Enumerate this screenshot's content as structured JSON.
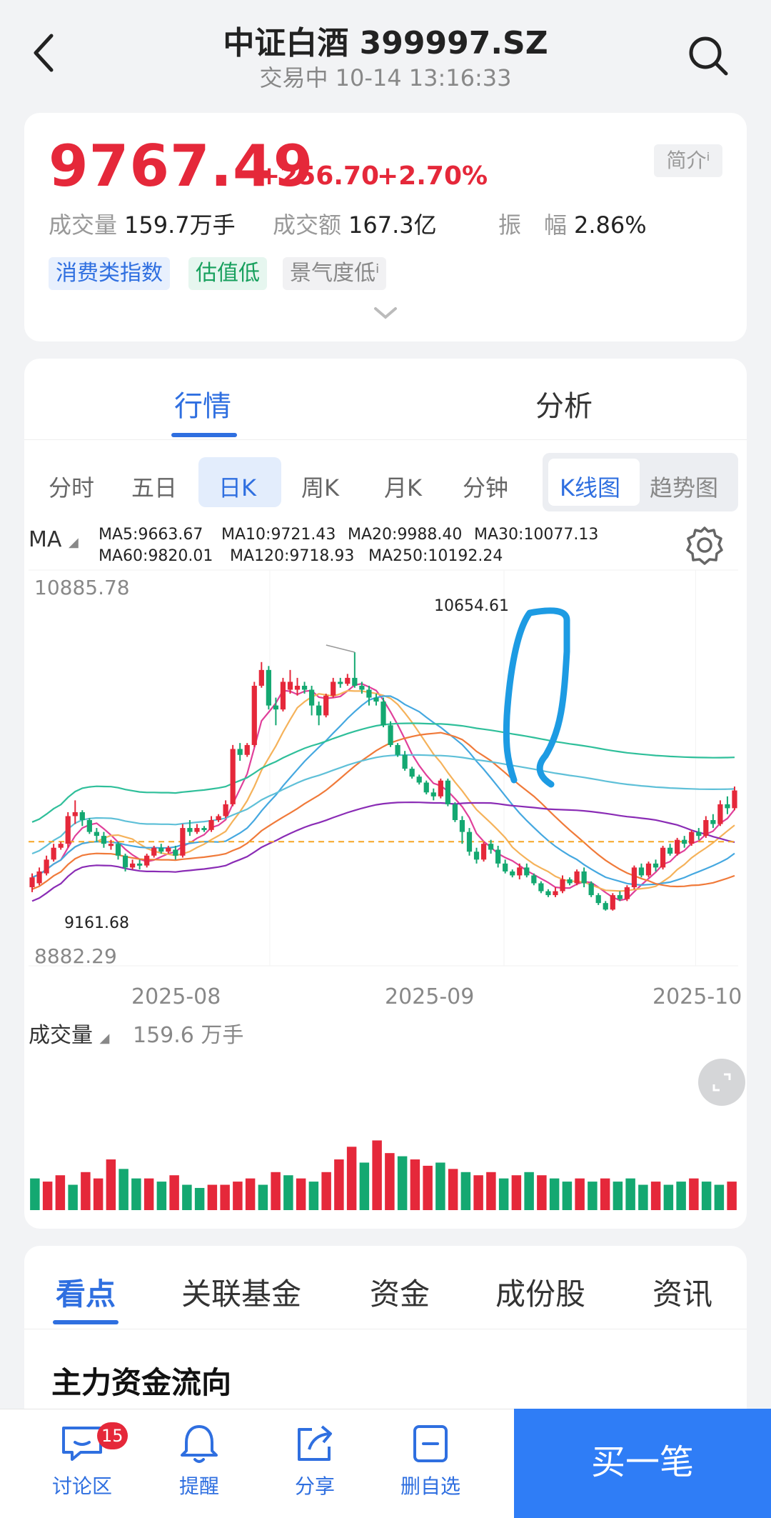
{
  "header": {
    "title": "中证白酒 399997.SZ",
    "subtitle": "交易中 10-14 13:16:33"
  },
  "quote": {
    "price": "9767.49",
    "change": "+256.70",
    "change_pct": "+2.70%",
    "intro_label": "简介ⁱ",
    "stats": [
      {
        "label": "成交量",
        "value": "159.7万手"
      },
      {
        "label": "成交额",
        "value": "167.3亿"
      },
      {
        "label": "振　幅",
        "value": "2.86%"
      }
    ],
    "tags": [
      "消费类指数",
      "估值低",
      "景气度低ⁱ"
    ]
  },
  "main_tabs": [
    "行情",
    "分析"
  ],
  "periods": [
    "分时",
    "五日",
    "日K",
    "周K",
    "月K",
    "分钟"
  ],
  "active_period": "日K",
  "chart_modes": [
    "K线图",
    "趋势图"
  ],
  "ma": {
    "selector": "MA",
    "values": [
      {
        "label": "MA5:9663.67",
        "color": "#e0409a"
      },
      {
        "label": "MA10:9721.43",
        "color": "#f5b25a"
      },
      {
        "label": "MA20:9988.40",
        "color": "#45a8e0"
      },
      {
        "label": "MA30:10077.13",
        "color": "#f07a3a"
      },
      {
        "label": "MA60:9820.01",
        "color": "#8a2cb5"
      },
      {
        "label": "MA120:9718.93",
        "color": "#5fc0d8"
      },
      {
        "label": "MA250:10192.24",
        "color": "#2fbf9a"
      }
    ]
  },
  "price_axis": {
    "top": "10885.78",
    "bottom": "8882.29",
    "high_mark": "10654.61",
    "low_mark": "9161.68"
  },
  "x_labels": [
    "2025-08",
    "2025-09",
    "2025-10"
  ],
  "volume": {
    "selector": "成交量",
    "value": "159.6 万手"
  },
  "chart_data": {
    "type": "candlestick",
    "title": "",
    "ylim": [
      8882.29,
      10885.78
    ],
    "high": 10654.61,
    "low": 9161.68,
    "ref_line": 9510.79,
    "candles": [
      [
        9280,
        9330,
        9255,
        9350,
        1
      ],
      [
        9300,
        9360,
        9290,
        9380,
        1
      ],
      [
        9350,
        9420,
        9340,
        9440,
        1
      ],
      [
        9420,
        9480,
        9410,
        9500,
        1
      ],
      [
        9480,
        9500,
        9470,
        9510,
        1
      ],
      [
        9500,
        9640,
        9480,
        9660,
        1
      ],
      [
        9640,
        9660,
        9600,
        9720,
        1
      ],
      [
        9660,
        9620,
        9590,
        9670,
        0
      ],
      [
        9620,
        9560,
        9550,
        9630,
        0
      ],
      [
        9560,
        9540,
        9510,
        9580,
        0
      ],
      [
        9540,
        9500,
        9480,
        9560,
        0
      ],
      [
        9500,
        9500,
        9470,
        9520,
        1
      ],
      [
        9500,
        9440,
        9420,
        9510,
        0
      ],
      [
        9440,
        9380,
        9360,
        9450,
        0
      ],
      [
        9380,
        9400,
        9370,
        9420,
        1
      ],
      [
        9400,
        9390,
        9370,
        9420,
        0
      ],
      [
        9390,
        9440,
        9380,
        9450,
        1
      ],
      [
        9440,
        9480,
        9430,
        9490,
        1
      ],
      [
        9480,
        9460,
        9450,
        9500,
        0
      ],
      [
        9460,
        9480,
        9450,
        9490,
        1
      ],
      [
        9470,
        9440,
        9420,
        9490,
        0
      ],
      [
        9440,
        9580,
        9430,
        9600,
        1
      ],
      [
        9580,
        9560,
        9540,
        9620,
        0
      ],
      [
        9560,
        9580,
        9550,
        9600,
        1
      ],
      [
        9580,
        9570,
        9560,
        9590,
        0
      ],
      [
        9570,
        9620,
        9560,
        9640,
        1
      ],
      [
        9620,
        9640,
        9610,
        9650,
        1
      ],
      [
        9640,
        9700,
        9630,
        9720,
        1
      ],
      [
        9700,
        9980,
        9690,
        10000,
        1
      ],
      [
        9980,
        9950,
        9920,
        10010,
        0
      ],
      [
        9950,
        10000,
        9940,
        10010,
        1
      ],
      [
        10000,
        10300,
        9990,
        10320,
        1
      ],
      [
        10300,
        10380,
        10290,
        10420,
        1
      ],
      [
        10380,
        10200,
        10180,
        10400,
        0
      ],
      [
        10200,
        10180,
        10100,
        10240,
        0
      ],
      [
        10180,
        10320,
        10170,
        10340,
        1
      ],
      [
        10320,
        10280,
        10260,
        10380,
        1
      ],
      [
        10280,
        10300,
        10250,
        10340,
        1
      ],
      [
        10300,
        10280,
        10260,
        10320,
        0
      ],
      [
        10280,
        10200,
        10150,
        10300,
        0
      ],
      [
        10200,
        10150,
        10100,
        10220,
        0
      ],
      [
        10150,
        10250,
        10140,
        10260,
        1
      ],
      [
        10250,
        10320,
        10240,
        10340,
        1
      ],
      [
        10320,
        10310,
        10290,
        10340,
        0
      ],
      [
        10310,
        10340,
        10300,
        10360,
        1
      ],
      [
        10340,
        10300,
        10290,
        10470,
        0
      ],
      [
        10300,
        10280,
        10260,
        10320,
        0
      ],
      [
        10280,
        10240,
        10200,
        10300,
        0
      ],
      [
        10240,
        10220,
        10200,
        10260,
        0
      ],
      [
        10220,
        10100,
        10090,
        10240,
        0
      ],
      [
        10100,
        10000,
        9990,
        10120,
        0
      ],
      [
        10000,
        9950,
        9940,
        10010,
        0
      ],
      [
        9950,
        9880,
        9870,
        9970,
        0
      ],
      [
        9880,
        9840,
        9830,
        9890,
        0
      ],
      [
        9840,
        9810,
        9800,
        9850,
        0
      ],
      [
        9810,
        9760,
        9750,
        9820,
        0
      ],
      [
        9760,
        9740,
        9720,
        9780,
        0
      ],
      [
        9740,
        9820,
        9730,
        9830,
        1
      ],
      [
        9820,
        9700,
        9690,
        9830,
        0
      ],
      [
        9700,
        9620,
        9610,
        9710,
        0
      ],
      [
        9620,
        9560,
        9500,
        9640,
        0
      ],
      [
        9560,
        9460,
        9440,
        9580,
        0
      ],
      [
        9460,
        9420,
        9400,
        9480,
        0
      ],
      [
        9420,
        9500,
        9410,
        9510,
        1
      ],
      [
        9500,
        9470,
        9450,
        9520,
        0
      ],
      [
        9470,
        9400,
        9380,
        9490,
        0
      ],
      [
        9400,
        9360,
        9350,
        9420,
        0
      ],
      [
        9360,
        9340,
        9330,
        9370,
        0
      ],
      [
        9340,
        9380,
        9320,
        9400,
        1
      ],
      [
        9380,
        9340,
        9330,
        9400,
        0
      ],
      [
        9340,
        9300,
        9290,
        9350,
        0
      ],
      [
        9300,
        9260,
        9250,
        9310,
        0
      ],
      [
        9260,
        9240,
        9230,
        9270,
        0
      ],
      [
        9240,
        9260,
        9230,
        9280,
        1
      ],
      [
        9260,
        9320,
        9250,
        9340,
        1
      ],
      [
        9320,
        9300,
        9290,
        9330,
        0
      ],
      [
        9300,
        9360,
        9290,
        9370,
        1
      ],
      [
        9360,
        9300,
        9280,
        9380,
        0
      ],
      [
        9300,
        9240,
        9230,
        9310,
        0
      ],
      [
        9240,
        9200,
        9190,
        9250,
        0
      ],
      [
        9200,
        9167,
        9161.68,
        9210,
        0
      ],
      [
        9167,
        9240,
        9161.68,
        9250,
        1
      ],
      [
        9240,
        9220,
        9210,
        9260,
        0
      ],
      [
        9220,
        9280,
        9210,
        9290,
        1
      ],
      [
        9280,
        9380,
        9270,
        9390,
        1
      ],
      [
        9380,
        9340,
        9330,
        9400,
        0
      ],
      [
        9340,
        9400,
        9330,
        9410,
        1
      ],
      [
        9400,
        9380,
        9360,
        9420,
        0
      ],
      [
        9380,
        9480,
        9370,
        9490,
        1
      ],
      [
        9480,
        9450,
        9440,
        9500,
        0
      ],
      [
        9450,
        9520,
        9440,
        9530,
        1
      ],
      [
        9520,
        9500,
        9480,
        9540,
        0
      ],
      [
        9500,
        9560,
        9490,
        9570,
        1
      ],
      [
        9560,
        9540,
        9520,
        9580,
        0
      ],
      [
        9540,
        9620,
        9530,
        9640,
        1
      ],
      [
        9620,
        9600,
        9580,
        9650,
        0
      ],
      [
        9600,
        9700,
        9590,
        9720,
        1
      ],
      [
        9700,
        9680,
        9650,
        9740,
        0
      ],
      [
        9680,
        9770,
        9670,
        9790,
        1
      ]
    ],
    "volume_series": [
      [
        1.0,
        0
      ],
      [
        0.9,
        1
      ],
      [
        1.1,
        1
      ],
      [
        0.8,
        0
      ],
      [
        1.2,
        1
      ],
      [
        1.0,
        1
      ],
      [
        1.6,
        1
      ],
      [
        1.3,
        0
      ],
      [
        1.0,
        0
      ],
      [
        1.0,
        1
      ],
      [
        0.9,
        0
      ],
      [
        1.1,
        1
      ],
      [
        0.8,
        0
      ],
      [
        0.7,
        0
      ],
      [
        0.8,
        1
      ],
      [
        0.8,
        1
      ],
      [
        0.9,
        1
      ],
      [
        1.0,
        1
      ],
      [
        0.8,
        0
      ],
      [
        1.2,
        1
      ],
      [
        1.1,
        0
      ],
      [
        1.0,
        1
      ],
      [
        0.9,
        0
      ],
      [
        1.2,
        1
      ],
      [
        1.6,
        1
      ],
      [
        2.0,
        1
      ],
      [
        1.5,
        0
      ],
      [
        2.2,
        1
      ],
      [
        1.8,
        1
      ],
      [
        1.7,
        0
      ],
      [
        1.6,
        1
      ],
      [
        1.4,
        1
      ],
      [
        1.5,
        0
      ],
      [
        1.3,
        1
      ],
      [
        1.2,
        0
      ],
      [
        1.1,
        1
      ],
      [
        1.2,
        1
      ],
      [
        1.0,
        0
      ],
      [
        1.1,
        1
      ],
      [
        1.2,
        0
      ],
      [
        1.1,
        1
      ],
      [
        1.0,
        0
      ],
      [
        0.9,
        0
      ],
      [
        1.0,
        1
      ],
      [
        0.9,
        0
      ],
      [
        1.0,
        1
      ],
      [
        0.9,
        0
      ],
      [
        1.0,
        0
      ],
      [
        0.8,
        0
      ],
      [
        0.9,
        1
      ],
      [
        0.8,
        0
      ],
      [
        0.9,
        0
      ],
      [
        1.0,
        1
      ],
      [
        0.9,
        0
      ],
      [
        0.8,
        0
      ],
      [
        0.9,
        1
      ]
    ]
  },
  "bottom_tabs": [
    "看点",
    "关联基金",
    "资金",
    "成份股",
    "资讯"
  ],
  "section_title": "主力资金流向",
  "bottom_nav": [
    {
      "label": "讨论区",
      "icon": "chat-icon",
      "badge": "15"
    },
    {
      "label": "提醒",
      "icon": "bell-icon"
    },
    {
      "label": "分享",
      "icon": "share-icon"
    },
    {
      "label": "删自选",
      "icon": "remove-watchlist-icon"
    }
  ],
  "buy_label": "买一笔",
  "colors": {
    "up": "#e5283a",
    "down": "#14a871",
    "accent": "#2f6fe0"
  }
}
